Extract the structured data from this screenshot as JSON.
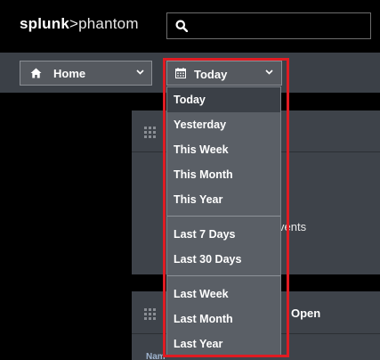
{
  "header": {
    "logo_bold": "splunk",
    "logo_light": ">phantom",
    "search": {
      "value": "",
      "icon": "search-icon"
    }
  },
  "nav": {
    "home_label": "Home",
    "date_label": "Today"
  },
  "dropdown": {
    "groups": [
      [
        "Today",
        "Yesterday",
        "This Week",
        "This Month",
        "This Year"
      ],
      [
        "Last 7 Days",
        "Last 30 Days"
      ],
      [
        "Last Week",
        "Last Month",
        "Last Year"
      ]
    ],
    "selected": "Today"
  },
  "background": {
    "events_text": "vents",
    "open_text": "Open",
    "name_text": "Nam"
  },
  "colors": {
    "highlight": "#e01b22",
    "menu_bg": "#5a5f66",
    "bar_bg": "#3b4047"
  }
}
